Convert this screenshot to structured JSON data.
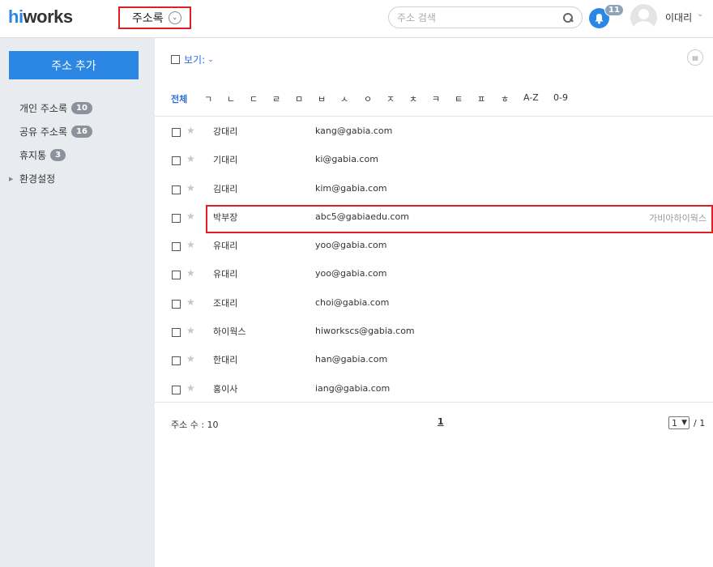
{
  "header": {
    "logo_hi": "hi",
    "logo_rest": "works",
    "app_title": "주소록",
    "search_placeholder": "주소 검색",
    "notification_count": "11",
    "user_name": "이대리"
  },
  "sidebar": {
    "add_button": "주소 추가",
    "items": [
      {
        "label": "개인 주소록",
        "badge": "10"
      },
      {
        "label": "공유 주소록",
        "badge": "16"
      },
      {
        "label": "휴지통",
        "badge": "3"
      },
      {
        "label": "환경설정",
        "badge": ""
      }
    ]
  },
  "toolbar": {
    "view_label": "보기:"
  },
  "alphabet": [
    "전체",
    "ㄱ",
    "ㄴ",
    "ㄷ",
    "ㄹ",
    "ㅁ",
    "ㅂ",
    "ㅅ",
    "ㅇ",
    "ㅈ",
    "ㅊ",
    "ㅋ",
    "ㅌ",
    "ㅍ",
    "ㅎ",
    "A-Z",
    "0-9"
  ],
  "contacts": [
    {
      "name": "강대리",
      "email": "kang@gabia.com",
      "company": ""
    },
    {
      "name": "기대리",
      "email": "ki@gabia.com",
      "company": ""
    },
    {
      "name": "김대리",
      "email": "kim@gabia.com",
      "company": ""
    },
    {
      "name": "박부장",
      "email": "abc5@gabiaedu.com",
      "company": "가비아하이웍스"
    },
    {
      "name": "유대리",
      "email": "yoo@gabia.com",
      "company": ""
    },
    {
      "name": "유대리",
      "email": "yoo@gabia.com",
      "company": ""
    },
    {
      "name": "조대리",
      "email": "choi@gabia.com",
      "company": ""
    },
    {
      "name": "하이웍스",
      "email": "hiworkscs@gabia.com",
      "company": ""
    },
    {
      "name": "한대리",
      "email": "han@gabia.com",
      "company": ""
    },
    {
      "name": "홍이사",
      "email": "iang@gabia.com",
      "company": ""
    }
  ],
  "footer": {
    "count_text": "주소 수 : 10",
    "current_page": "1",
    "page_select_value": "1",
    "total_pages": "/ 1"
  },
  "colors": {
    "accent": "#2b87e3",
    "highlight_border": "#e01e24",
    "sidebar_bg": "#e8ebef"
  }
}
